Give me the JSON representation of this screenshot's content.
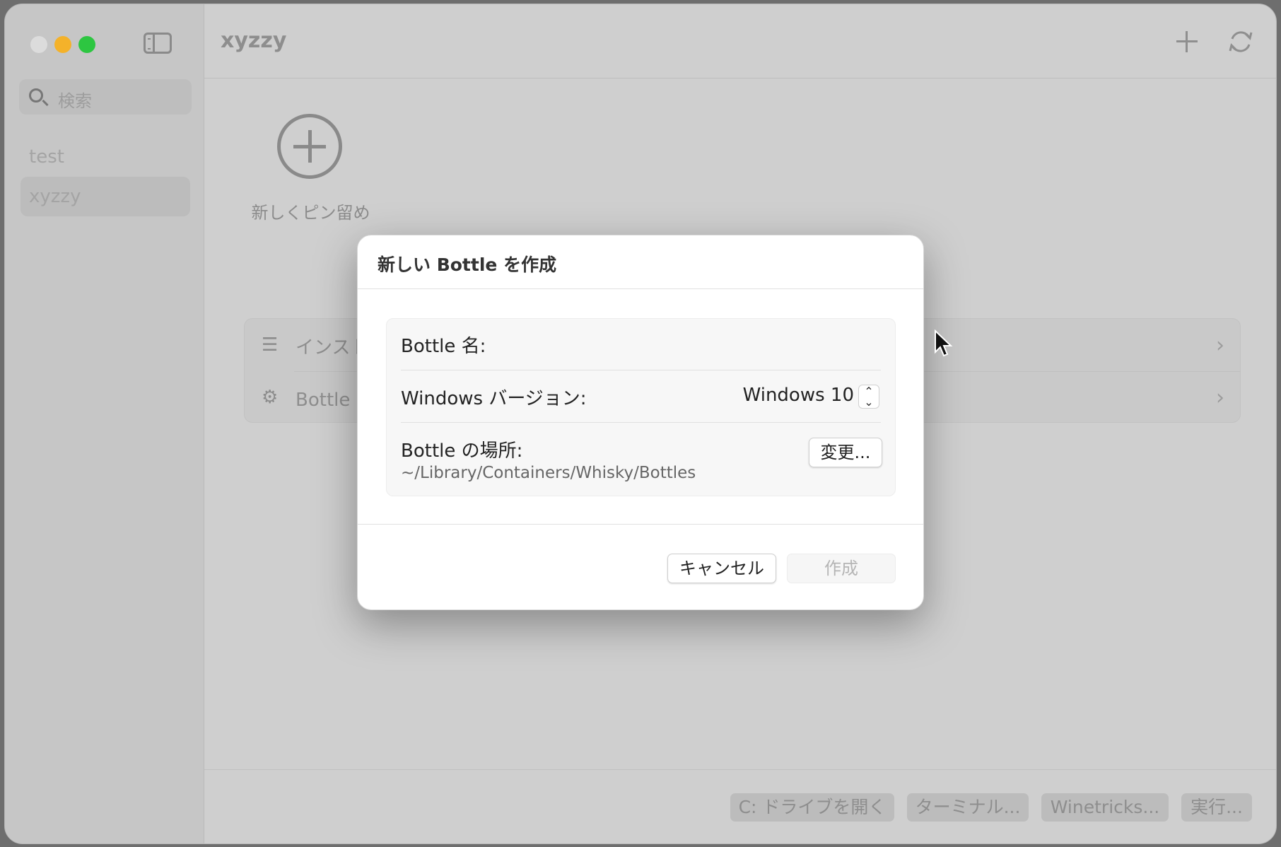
{
  "window": {
    "title": "xyzzy",
    "colors": {
      "close": "#e0e0e0",
      "minimize": "#f5b32b",
      "zoom": "#2ec642"
    }
  },
  "sidebar": {
    "search_placeholder": "検索",
    "items": [
      {
        "label": "test",
        "selected": false
      },
      {
        "label": "xyzzy",
        "selected": true
      }
    ]
  },
  "main": {
    "pin_label": "新しくピン留め",
    "rows": [
      {
        "label": "インスト",
        "icon": "list-icon"
      },
      {
        "label": "Bottle の",
        "icon": "gear-icon"
      }
    ],
    "bottom_buttons": [
      "C: ドライブを開く",
      "ターミナル...",
      "Winetricks...",
      "実行..."
    ]
  },
  "dialog": {
    "title": "新しい Bottle を作成",
    "name_label": "Bottle 名:",
    "version_label": "Windows バージョン:",
    "version_value": "Windows 10",
    "location_label": "Bottle の場所:",
    "location_path": "~/Library/Containers/Whisky/Bottles",
    "change_button": "変更...",
    "cancel_button": "キャンセル",
    "create_button": "作成"
  }
}
